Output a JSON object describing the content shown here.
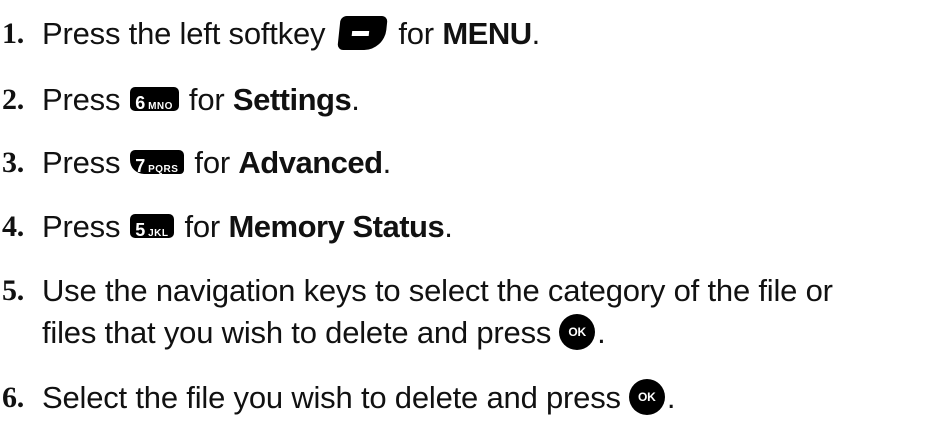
{
  "steps": [
    {
      "number": "1.",
      "before": "Press the left softkey",
      "key_icon": "left-softkey-icon",
      "mid": "for",
      "bold": "MENU",
      "after": "."
    },
    {
      "number": "2.",
      "before": "Press",
      "key_icon": "key-6-mno-icon",
      "key_digit": "6",
      "key_letters": "MNO",
      "mid": "for",
      "bold": "Settings",
      "after": "."
    },
    {
      "number": "3.",
      "before": "Press",
      "key_icon": "key-7-pqrs-icon",
      "key_digit": "7",
      "key_letters": "PQRS",
      "mid": "for",
      "bold": "Advanced",
      "after": "."
    },
    {
      "number": "4.",
      "before": "Press",
      "key_icon": "key-5-jkl-icon",
      "key_digit": "5",
      "key_letters": "JKL",
      "mid": "for",
      "bold": "Memory Status",
      "after": "."
    },
    {
      "number": "5.",
      "line1": "Use the navigation keys to select the category of the file or",
      "line2": "files that you wish to delete and press",
      "key_icon": "ok-key-icon",
      "key_label": "OK",
      "after": "."
    },
    {
      "number": "6.",
      "before": "Select the file you wish to delete and press",
      "key_icon": "ok-key-icon",
      "key_label": "OK",
      "after": "."
    }
  ]
}
